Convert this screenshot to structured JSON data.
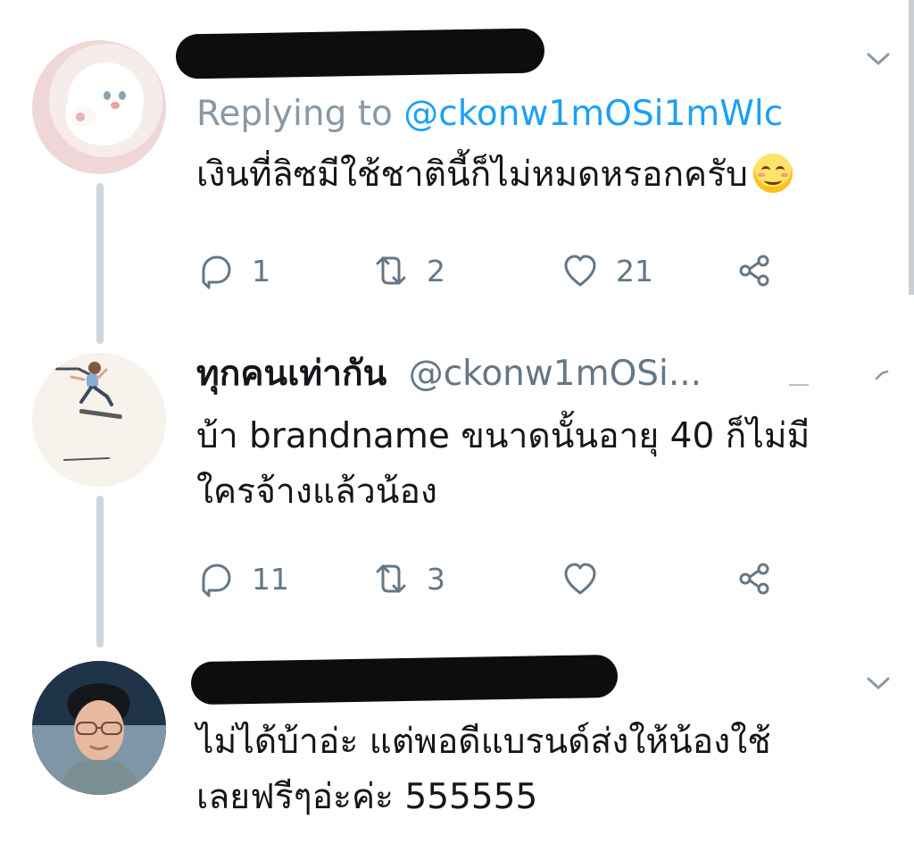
{
  "thread": [
    {
      "avatar": "cat-avatar",
      "reply_prefix": "Replying to",
      "reply_handle": "@ckonw1mOSi1mWlc",
      "text": "เงินที่ลิซมีใช้ชาตินี้ก็ไม่หมดหรอกครับ",
      "emoji": "smiling-face-emoji",
      "actions": {
        "reply_count": "1",
        "retweet_count": "2",
        "like_count": "21"
      }
    },
    {
      "avatar": "skateboarder-avatar",
      "name": "ทุกคนเท่ากัน",
      "handle": "@ckonw1mOSi...",
      "text_line1": "บ้า brandname ขนาดนั้นอายุ 40 ก็ไม่มี",
      "text_line2": "ใครจ้างแล้วน้อง",
      "actions": {
        "reply_count": "11",
        "retweet_count": "3",
        "like_count": ""
      }
    },
    {
      "avatar": "person-avatar",
      "text_line1": "ไม่ได้บ้าอ่ะ แต่พอดีแบรนด์ส่งให้น้องใช้",
      "text_line2": "เลยฟรีๆอ่ะค่ะ 555555"
    }
  ],
  "icons": {
    "reply": "reply-icon",
    "retweet": "retweet-icon",
    "like": "heart-icon",
    "share": "share-icon",
    "menu": "chevron-down-icon"
  },
  "colors": {
    "link_blue": "#1da1f2",
    "muted_gray": "#657786",
    "thread_line": "#ccd6dd",
    "text": "#14171a"
  }
}
